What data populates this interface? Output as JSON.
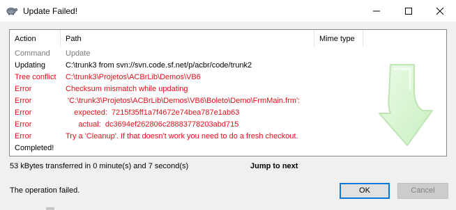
{
  "window": {
    "title": "Update Failed!",
    "icon": "tortoisesvn-icon",
    "controls": [
      "minimize-icon",
      "maximize-icon",
      "close-icon"
    ]
  },
  "table": {
    "headers": {
      "action": "Action",
      "path": "Path",
      "mime": "Mime type"
    },
    "rows": [
      {
        "action": "Command",
        "path": "Update",
        "color": "#7a7a7a"
      },
      {
        "action": "Updating",
        "path": "C:\\trunk3 from svn://svn.code.sf.net/p/acbr/code/trunk2",
        "color": "#000000"
      },
      {
        "action": "Tree conflict",
        "path": "C:\\trunk3\\Projetos\\ACBrLib\\Demos\\VB6",
        "color": "#e0101a"
      },
      {
        "action": "Error",
        "path": "Checksum mismatch while updating",
        "color": "#e0101a"
      },
      {
        "action": "Error",
        "path": " 'C:\\trunk3\\Projetos\\ACBrLib\\Demos\\VB6\\Boleto\\Demo\\FrmMain.frm':",
        "color": "#e0101a"
      },
      {
        "action": "Error",
        "path": "    expected:  7215f35ff1a7f4672e74bea787e1ab63",
        "color": "#e0101a"
      },
      {
        "action": "Error",
        "path": "      actual:  dc3694ef262806c28883778203abd715",
        "color": "#e0101a"
      },
      {
        "action": "Error",
        "path": "Try a 'Cleanup'. If that doesn't work you need to do a fresh checkout.",
        "color": "#e0101a"
      },
      {
        "action": "Completed!",
        "path": "",
        "color": "#000000"
      }
    ]
  },
  "status": {
    "transfer": "53 kBytes transferred in 0 minute(s) and 7 second(s)",
    "jump_label": "Jump to next",
    "operation": "The operation failed."
  },
  "buttons": {
    "ok": "OK",
    "cancel": "Cancel"
  }
}
